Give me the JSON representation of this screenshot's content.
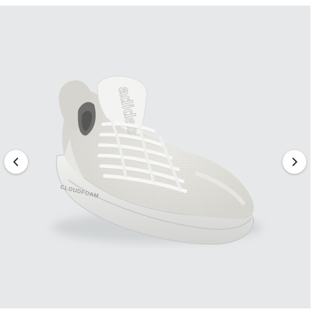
{
  "gallery": {
    "background_color": "#e6e8e9",
    "image": {
      "subject": "white mesh slip-on running sneaker",
      "tongue_print": "adidas",
      "side_print": "CLOUDFOAM"
    },
    "prev_icon": "chevron-left-icon",
    "next_icon": "chevron-right-icon"
  }
}
